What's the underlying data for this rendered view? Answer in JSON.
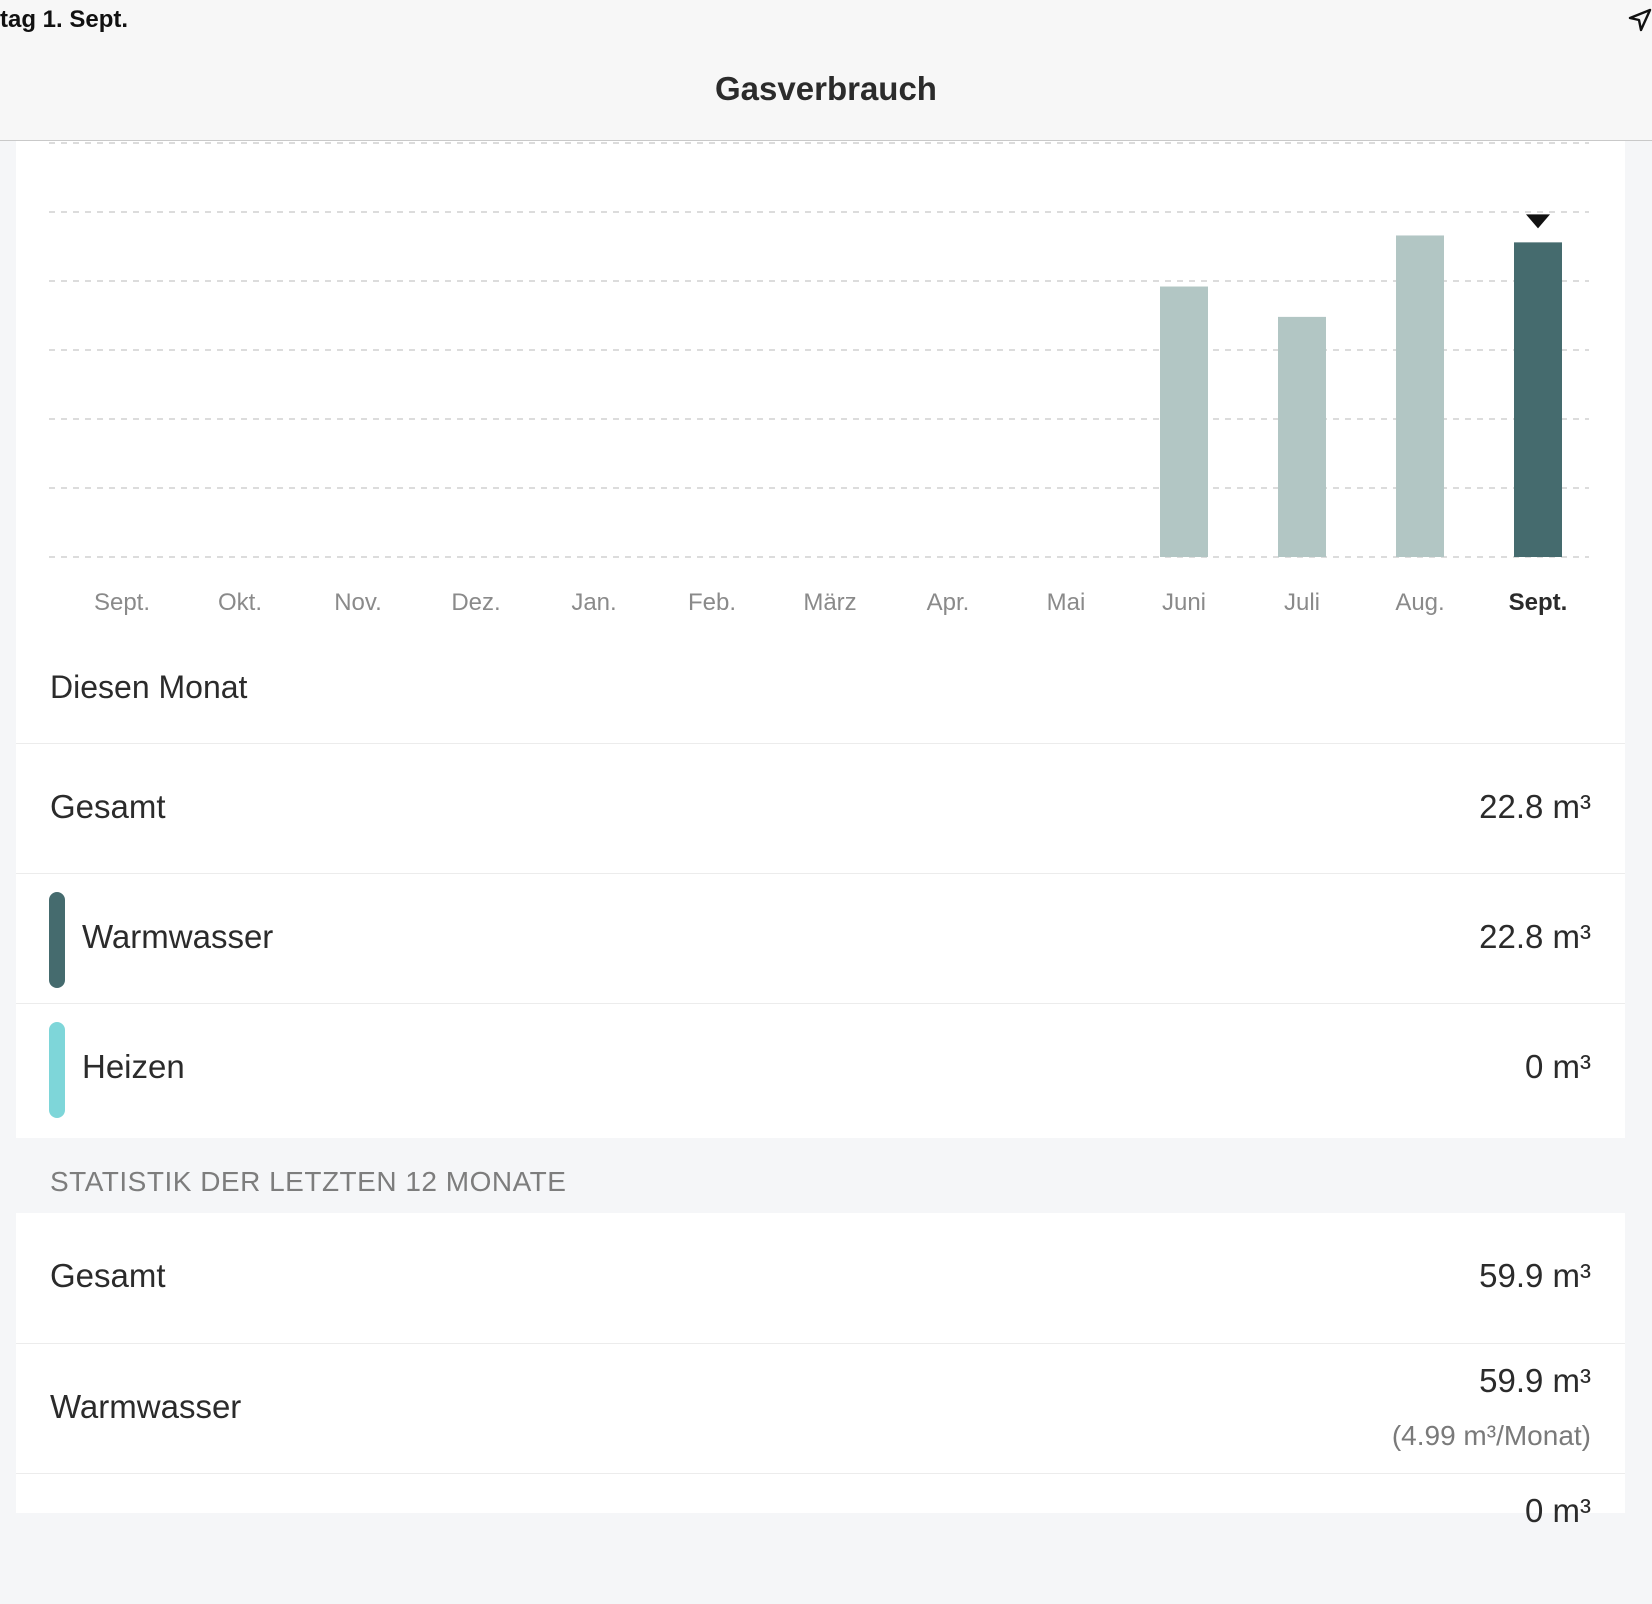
{
  "status_bar": {
    "date": "tag 1. Sept."
  },
  "nav": {
    "title": "Gasverbrauch"
  },
  "chart_data": {
    "type": "bar",
    "categories": [
      "Sept.",
      "Okt.",
      "Nov.",
      "Dez.",
      "Jan.",
      "Feb.",
      "März",
      "Apr.",
      "Mai",
      "Juni",
      "Juli",
      "Aug.",
      "Sept."
    ],
    "values": [
      0,
      0,
      0,
      0,
      0,
      0,
      0,
      0,
      0,
      19.6,
      17.4,
      23.3,
      22.8
    ],
    "selected_index": 12,
    "ylim": [
      0,
      30
    ],
    "grid": true,
    "colors": {
      "normal": "#b2c6c4",
      "selected": "#456b6e"
    }
  },
  "month": {
    "title": "Diesen Monat",
    "total": {
      "label": "Gesamt",
      "value": "22.8 m³"
    },
    "warmwater": {
      "label": "Warmwasser",
      "value": "22.8 m³",
      "color": "#456b6e"
    },
    "heating": {
      "label": "Heizen",
      "value": "0 m³",
      "color": "#7ed6d9"
    }
  },
  "stats": {
    "header": "STATISTIK DER LETZTEN 12 MONATE",
    "total": {
      "label": "Gesamt",
      "value": "59.9 m³"
    },
    "warmwater": {
      "label": "Warmwasser",
      "value": "59.9 m³",
      "sub": "(4.99 m³/Monat)"
    },
    "heating": {
      "value": "0 m³"
    }
  }
}
